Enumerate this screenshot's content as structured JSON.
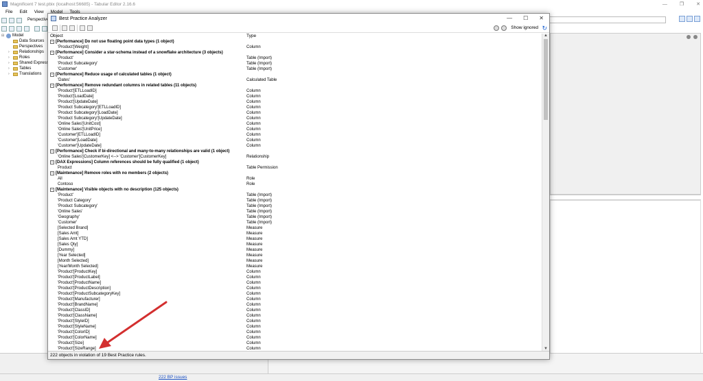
{
  "app": {
    "title": "Magnificent 7 test.pbix (localhost:56685) - Tabular Editor 2.16.6",
    "menu": [
      "File",
      "Edit",
      "View",
      "Model",
      "Tools"
    ],
    "perspective_label": "Perspective"
  },
  "tree": {
    "items": [
      {
        "label": "Model",
        "indent": 0,
        "expander": "⊟"
      },
      {
        "label": "Data Sources",
        "indent": 1,
        "expander": ""
      },
      {
        "label": "Perspectives",
        "indent": 1,
        "expander": ""
      },
      {
        "label": "Relationships",
        "indent": 1,
        "expander": "›"
      },
      {
        "label": "Roles",
        "indent": 1,
        "expander": "›"
      },
      {
        "label": "Shared Expressio",
        "indent": 1,
        "expander": "›"
      },
      {
        "label": "Tables",
        "indent": 1,
        "expander": "›"
      },
      {
        "label": "Translations",
        "indent": 1,
        "expander": "›"
      }
    ]
  },
  "statusbar": {
    "bpa_issues_link": "222 BP issues"
  },
  "bpa": {
    "title": "Best Practice Analyzer",
    "show_ignored": "Show ignored",
    "columns": {
      "object": "Object",
      "type": "Type"
    },
    "status": "222 objects in violation of 19 Best Practice rules.",
    "rows": [
      {
        "g": true,
        "obj": "[Performance] Do not use floating point data types (1 object)",
        "typ": ""
      },
      {
        "g": false,
        "obj": "'Product'[Weight]",
        "typ": "Column"
      },
      {
        "g": true,
        "obj": "[Performance] Consider a star-schema instead of a snowflake architecture (3 objects)",
        "typ": ""
      },
      {
        "g": false,
        "obj": "'Product'",
        "typ": "Table (Import)"
      },
      {
        "g": false,
        "obj": "'Product Subcategory'",
        "typ": "Table (Import)"
      },
      {
        "g": false,
        "obj": "'Customer'",
        "typ": "Table (Import)"
      },
      {
        "g": true,
        "obj": "[Performance] Reduce usage of calculated tables (1 object)",
        "typ": ""
      },
      {
        "g": false,
        "obj": "'Dates'",
        "typ": "Calculated Table"
      },
      {
        "g": true,
        "obj": "[Performance] Remove redundant columns in related tables (11 objects)",
        "typ": ""
      },
      {
        "g": false,
        "obj": "'Product'[ETLLoadID]",
        "typ": "Column"
      },
      {
        "g": false,
        "obj": "'Product'[LoadDate]",
        "typ": "Column"
      },
      {
        "g": false,
        "obj": "'Product'[UpdateDate]",
        "typ": "Column"
      },
      {
        "g": false,
        "obj": "'Product Subcategory'[ETLLoadID]",
        "typ": "Column"
      },
      {
        "g": false,
        "obj": "'Product Subcategory'[LoadDate]",
        "typ": "Column"
      },
      {
        "g": false,
        "obj": "'Product Subcategory'[UpdateDate]",
        "typ": "Column"
      },
      {
        "g": false,
        "obj": "'Online Sales'[UnitCost]",
        "typ": "Column"
      },
      {
        "g": false,
        "obj": "'Online Sales'[UnitPrice]",
        "typ": "Column"
      },
      {
        "g": false,
        "obj": "'Customer'[ETLLoadID]",
        "typ": "Column"
      },
      {
        "g": false,
        "obj": "'Customer'[LoadDate]",
        "typ": "Column"
      },
      {
        "g": false,
        "obj": "'Customer'[UpdateDate]",
        "typ": "Column"
      },
      {
        "g": true,
        "obj": "[Performance] Check if bi-directional and many-to-many relationships are valid (1 object)",
        "typ": ""
      },
      {
        "g": false,
        "obj": "'Online Sales'[CustomerKey] <--> 'Customer'[CustomerKey]",
        "typ": "Relationship"
      },
      {
        "g": true,
        "obj": "[DAX Expressions] Column references should be fully qualified (1 object)",
        "typ": ""
      },
      {
        "g": false,
        "obj": "Product",
        "typ": "Table Permission"
      },
      {
        "g": true,
        "obj": "[Maintenance] Remove roles with no members (2 objects)",
        "typ": ""
      },
      {
        "g": false,
        "obj": "All",
        "typ": "Role"
      },
      {
        "g": false,
        "obj": "Contoso",
        "typ": "Role"
      },
      {
        "g": true,
        "obj": "[Maintenance] Visible objects with no description (125 objects)",
        "typ": ""
      },
      {
        "g": false,
        "obj": "'Product'",
        "typ": "Table (Import)"
      },
      {
        "g": false,
        "obj": "'Product Category'",
        "typ": "Table (Import)"
      },
      {
        "g": false,
        "obj": "'Product Subcategory'",
        "typ": "Table (Import)"
      },
      {
        "g": false,
        "obj": "'Online Sales'",
        "typ": "Table (Import)"
      },
      {
        "g": false,
        "obj": "'Geography'",
        "typ": "Table (Import)"
      },
      {
        "g": false,
        "obj": "'Customer'",
        "typ": "Table (Import)"
      },
      {
        "g": false,
        "obj": "[Selected Brand]",
        "typ": "Measure"
      },
      {
        "g": false,
        "obj": "[Sales Amt]",
        "typ": "Measure"
      },
      {
        "g": false,
        "obj": "[Sales Amt YTD]",
        "typ": "Measure"
      },
      {
        "g": false,
        "obj": "[Sales Qty]",
        "typ": "Measure"
      },
      {
        "g": false,
        "obj": "[Dummy]",
        "typ": "Measure"
      },
      {
        "g": false,
        "obj": "[Year Selected]",
        "typ": "Measure"
      },
      {
        "g": false,
        "obj": "[Month Selected]",
        "typ": "Measure"
      },
      {
        "g": false,
        "obj": "[Year/Month Selected]",
        "typ": "Measure"
      },
      {
        "g": false,
        "obj": "'Product'[ProductKey]",
        "typ": "Column"
      },
      {
        "g": false,
        "obj": "'Product'[ProductLabel]",
        "typ": "Column"
      },
      {
        "g": false,
        "obj": "'Product'[ProductName]",
        "typ": "Column"
      },
      {
        "g": false,
        "obj": "'Product'[ProductDescription]",
        "typ": "Column"
      },
      {
        "g": false,
        "obj": "'Product'[ProductSubcategoryKey]",
        "typ": "Column"
      },
      {
        "g": false,
        "obj": "'Product'[Manufacturer]",
        "typ": "Column"
      },
      {
        "g": false,
        "obj": "'Product'[BrandName]",
        "typ": "Column"
      },
      {
        "g": false,
        "obj": "'Product'[ClassID]",
        "typ": "Column"
      },
      {
        "g": false,
        "obj": "'Product'[ClassName]",
        "typ": "Column"
      },
      {
        "g": false,
        "obj": "'Product'[StyleID]",
        "typ": "Column"
      },
      {
        "g": false,
        "obj": "'Product'[StyleName]",
        "typ": "Column"
      },
      {
        "g": false,
        "obj": "'Product'[ColorID]",
        "typ": "Column"
      },
      {
        "g": false,
        "obj": "'Product'[ColorName]",
        "typ": "Column"
      },
      {
        "g": false,
        "obj": "'Product'[Size]",
        "typ": "Column"
      },
      {
        "g": false,
        "obj": "'Product'[SizeRange]",
        "typ": "Column"
      }
    ]
  },
  "colors": {
    "annotation_arrow": "#d32f2f",
    "link": "#1a4fc2"
  }
}
